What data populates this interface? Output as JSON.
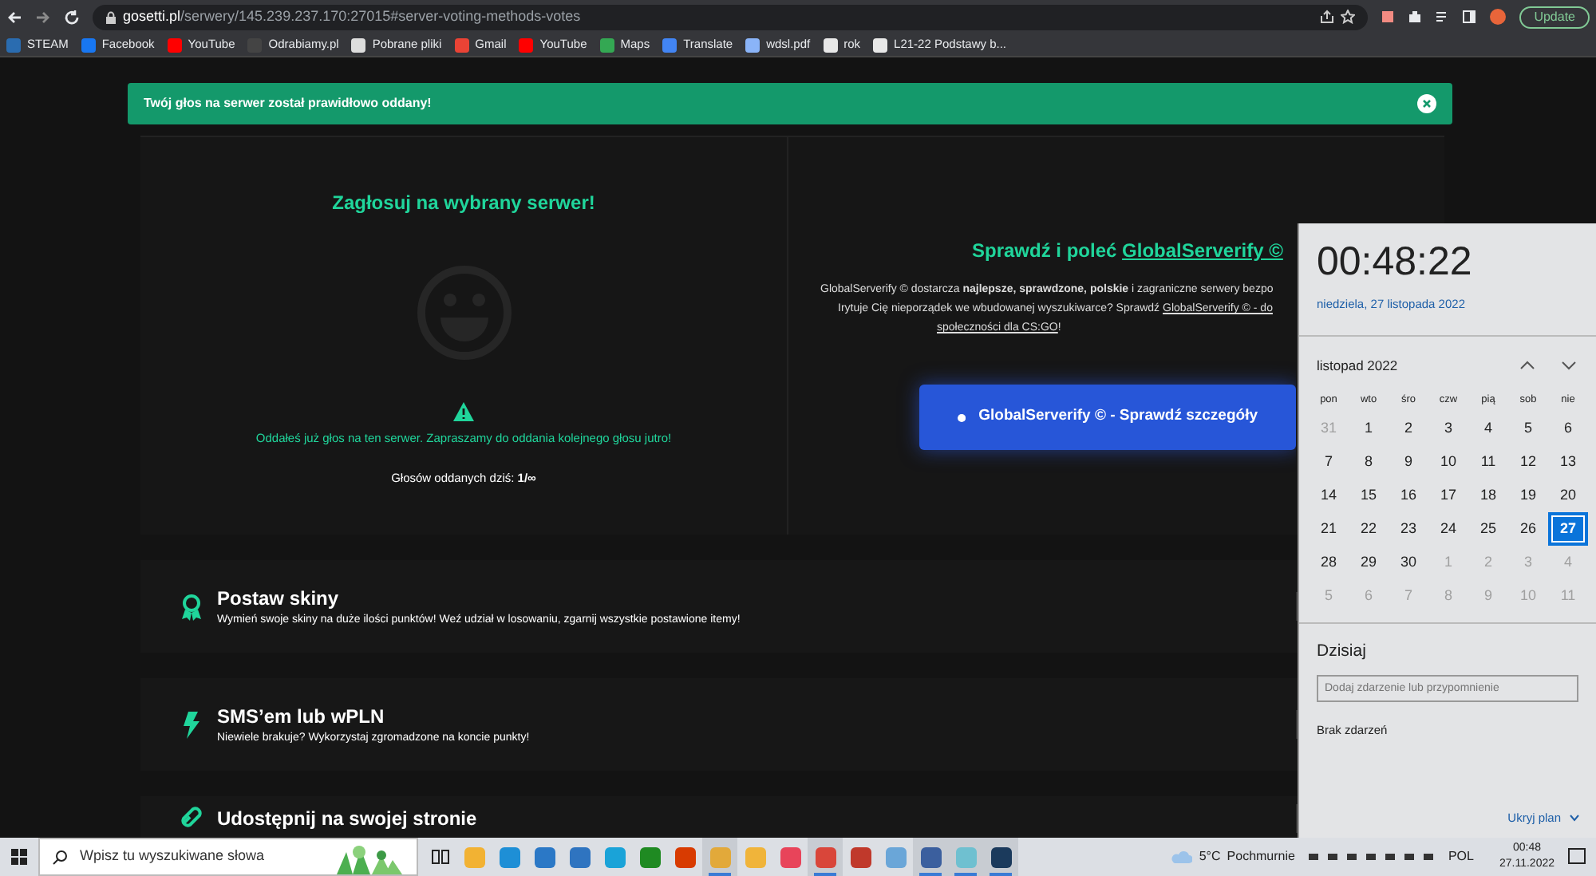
{
  "browser": {
    "url_host": "gosetti.pl",
    "url_path": "/serwery/145.239.237.170:27015#server-voting-methods-votes",
    "update_button": "Update",
    "bookmarks": [
      {
        "label": "STEAM",
        "color": "#2a6cb0"
      },
      {
        "label": "Facebook",
        "color": "#1877f2"
      },
      {
        "label": "YouTube",
        "color": "#ff0000"
      },
      {
        "label": "Odrabiamy.pl",
        "color": "#444444"
      },
      {
        "label": "Pobrane pliki",
        "color": "#dddddd"
      },
      {
        "label": "Gmail",
        "color": "#ea4335"
      },
      {
        "label": "YouTube",
        "color": "#ff0000"
      },
      {
        "label": "Maps",
        "color": "#34a853"
      },
      {
        "label": "Translate",
        "color": "#4285f4"
      },
      {
        "label": "wdsl.pdf",
        "color": "#8ab4f8"
      },
      {
        "label": "rok",
        "color": "#e8e8e8"
      },
      {
        "label": "L21-22 Podstawy b...",
        "color": "#e8e8e8"
      }
    ]
  },
  "alert": {
    "text": "Twój głos na serwer został prawidłowo oddany!"
  },
  "vote": {
    "title": "Zagłosuj na wybrany serwer!",
    "notice": "Oddałeś już głos na ten serwer. Zapraszamy do oddania kolejnego głosu jutro!",
    "count": "Głosów oddanych dziś: **1/∞**"
  },
  "promo": {
    "title": "Sprawdź i poleć",
    "title_link": "GlobalServerify ©",
    "lines": [
      {
        "text": "GlobalServerify © dostarcza **najlepsze, sprawdzone, polskie** i zagraniczne serwery bezpo"
      },
      {
        "text": "Irytuje Cię nieporządek we wbudowanej wyszukiwarce? Sprawdź",
        "link": "GlobalServerify © - do"
      },
      {
        "link": "społeczności dla CS:GO",
        "text_after": "!"
      }
    ],
    "button": "GlobalServerify © - Sprawdź szczegóły"
  },
  "features": [
    {
      "kind": "award",
      "title": "Postaw skiny",
      "description": "Wymień swoje skiny na duże ilości punktów! Weź udział w losowaniu, zgarnij wszystkie postawione itemy!"
    },
    {
      "kind": "bolt",
      "title": "SMS’em lub wPLN",
      "description": "Niewiele brakuje? Wykorzystaj zgromadzone na koncie punkty!"
    },
    {
      "kind": "link",
      "title": "Udostępnij na swojej stronie"
    }
  ],
  "calendar": {
    "time": "00:48:22",
    "date": "niedziela, 27 listopada 2022",
    "month": "listopad 2022",
    "weekdays": [
      "pon",
      "wto",
      "śro",
      "czw",
      "pią",
      "sob",
      "nie"
    ],
    "days": [
      {
        "label": "31",
        "muted": true,
        "selected": false
      },
      {
        "label": "1",
        "muted": false,
        "selected": false
      },
      {
        "label": "2",
        "muted": false,
        "selected": false
      },
      {
        "label": "3",
        "muted": false,
        "selected": false
      },
      {
        "label": "4",
        "muted": false,
        "selected": false
      },
      {
        "label": "5",
        "muted": false,
        "selected": false
      },
      {
        "label": "6",
        "muted": false,
        "selected": false
      },
      {
        "label": "7",
        "muted": false,
        "selected": false
      },
      {
        "label": "8",
        "muted": false,
        "selected": false
      },
      {
        "label": "9",
        "muted": false,
        "selected": false
      },
      {
        "label": "10",
        "muted": false,
        "selected": false
      },
      {
        "label": "11",
        "muted": false,
        "selected": false
      },
      {
        "label": "12",
        "muted": false,
        "selected": false
      },
      {
        "label": "13",
        "muted": false,
        "selected": false
      },
      {
        "label": "14",
        "muted": false,
        "selected": false
      },
      {
        "label": "15",
        "muted": false,
        "selected": false
      },
      {
        "label": "16",
        "muted": false,
        "selected": false
      },
      {
        "label": "17",
        "muted": false,
        "selected": false
      },
      {
        "label": "18",
        "muted": false,
        "selected": false
      },
      {
        "label": "19",
        "muted": false,
        "selected": false
      },
      {
        "label": "20",
        "muted": false,
        "selected": false
      },
      {
        "label": "21",
        "muted": false,
        "selected": false
      },
      {
        "label": "22",
        "muted": false,
        "selected": false
      },
      {
        "label": "23",
        "muted": false,
        "selected": false
      },
      {
        "label": "24",
        "muted": false,
        "selected": false
      },
      {
        "label": "25",
        "muted": false,
        "selected": false
      },
      {
        "label": "26",
        "muted": false,
        "selected": false
      },
      {
        "label": "27",
        "muted": false,
        "selected": true
      },
      {
        "label": "28",
        "muted": false,
        "selected": false
      },
      {
        "label": "29",
        "muted": false,
        "selected": false
      },
      {
        "label": "30",
        "muted": false,
        "selected": false
      },
      {
        "label": "1",
        "muted": true,
        "selected": false
      },
      {
        "label": "2",
        "muted": true,
        "selected": false
      },
      {
        "label": "3",
        "muted": true,
        "selected": false
      },
      {
        "label": "4",
        "muted": true,
        "selected": false
      },
      {
        "label": "5",
        "muted": true,
        "selected": false
      },
      {
        "label": "6",
        "muted": true,
        "selected": false
      },
      {
        "label": "7",
        "muted": true,
        "selected": false
      },
      {
        "label": "8",
        "muted": true,
        "selected": false
      },
      {
        "label": "9",
        "muted": true,
        "selected": false
      },
      {
        "label": "10",
        "muted": true,
        "selected": false
      },
      {
        "label": "11",
        "muted": true,
        "selected": false
      }
    ],
    "today": "Dzisiaj",
    "event_placeholder": "Dodaj zdarzenie lub przypomnienie",
    "no_events": "Brak zdarzeń",
    "hide_plan": "Ukryj plan"
  },
  "taskbar": {
    "search_placeholder": "Wpisz tu wyszukiwane słowa",
    "apps": [
      {
        "color": "#f2b233",
        "active": false
      },
      {
        "color": "#1e8fd6",
        "active": false
      },
      {
        "color": "#2b78c6",
        "active": false
      },
      {
        "color": "#2f74c0",
        "active": false
      },
      {
        "color": "#1aa3d8",
        "active": false
      },
      {
        "color": "#1f8a22",
        "active": false
      },
      {
        "color": "#d83b01",
        "active": false
      },
      {
        "color": "#e2a93a",
        "active": true
      },
      {
        "color": "#f0b43a",
        "active": false
      },
      {
        "color": "#e8445a",
        "active": false
      },
      {
        "color": "#d9463a",
        "active": true
      },
      {
        "color": "#c0392b",
        "active": false
      },
      {
        "color": "#6aa6d8",
        "active": false
      },
      {
        "color": "#3b5f9e",
        "active": true
      },
      {
        "color": "#6fc0d0",
        "active": true
      },
      {
        "color": "#1b3a5c",
        "active": true
      }
    ],
    "temperature": "5°C",
    "weather": "Pochmurnie",
    "language": "POL",
    "time": "00:48",
    "date": "27.11.2022"
  }
}
